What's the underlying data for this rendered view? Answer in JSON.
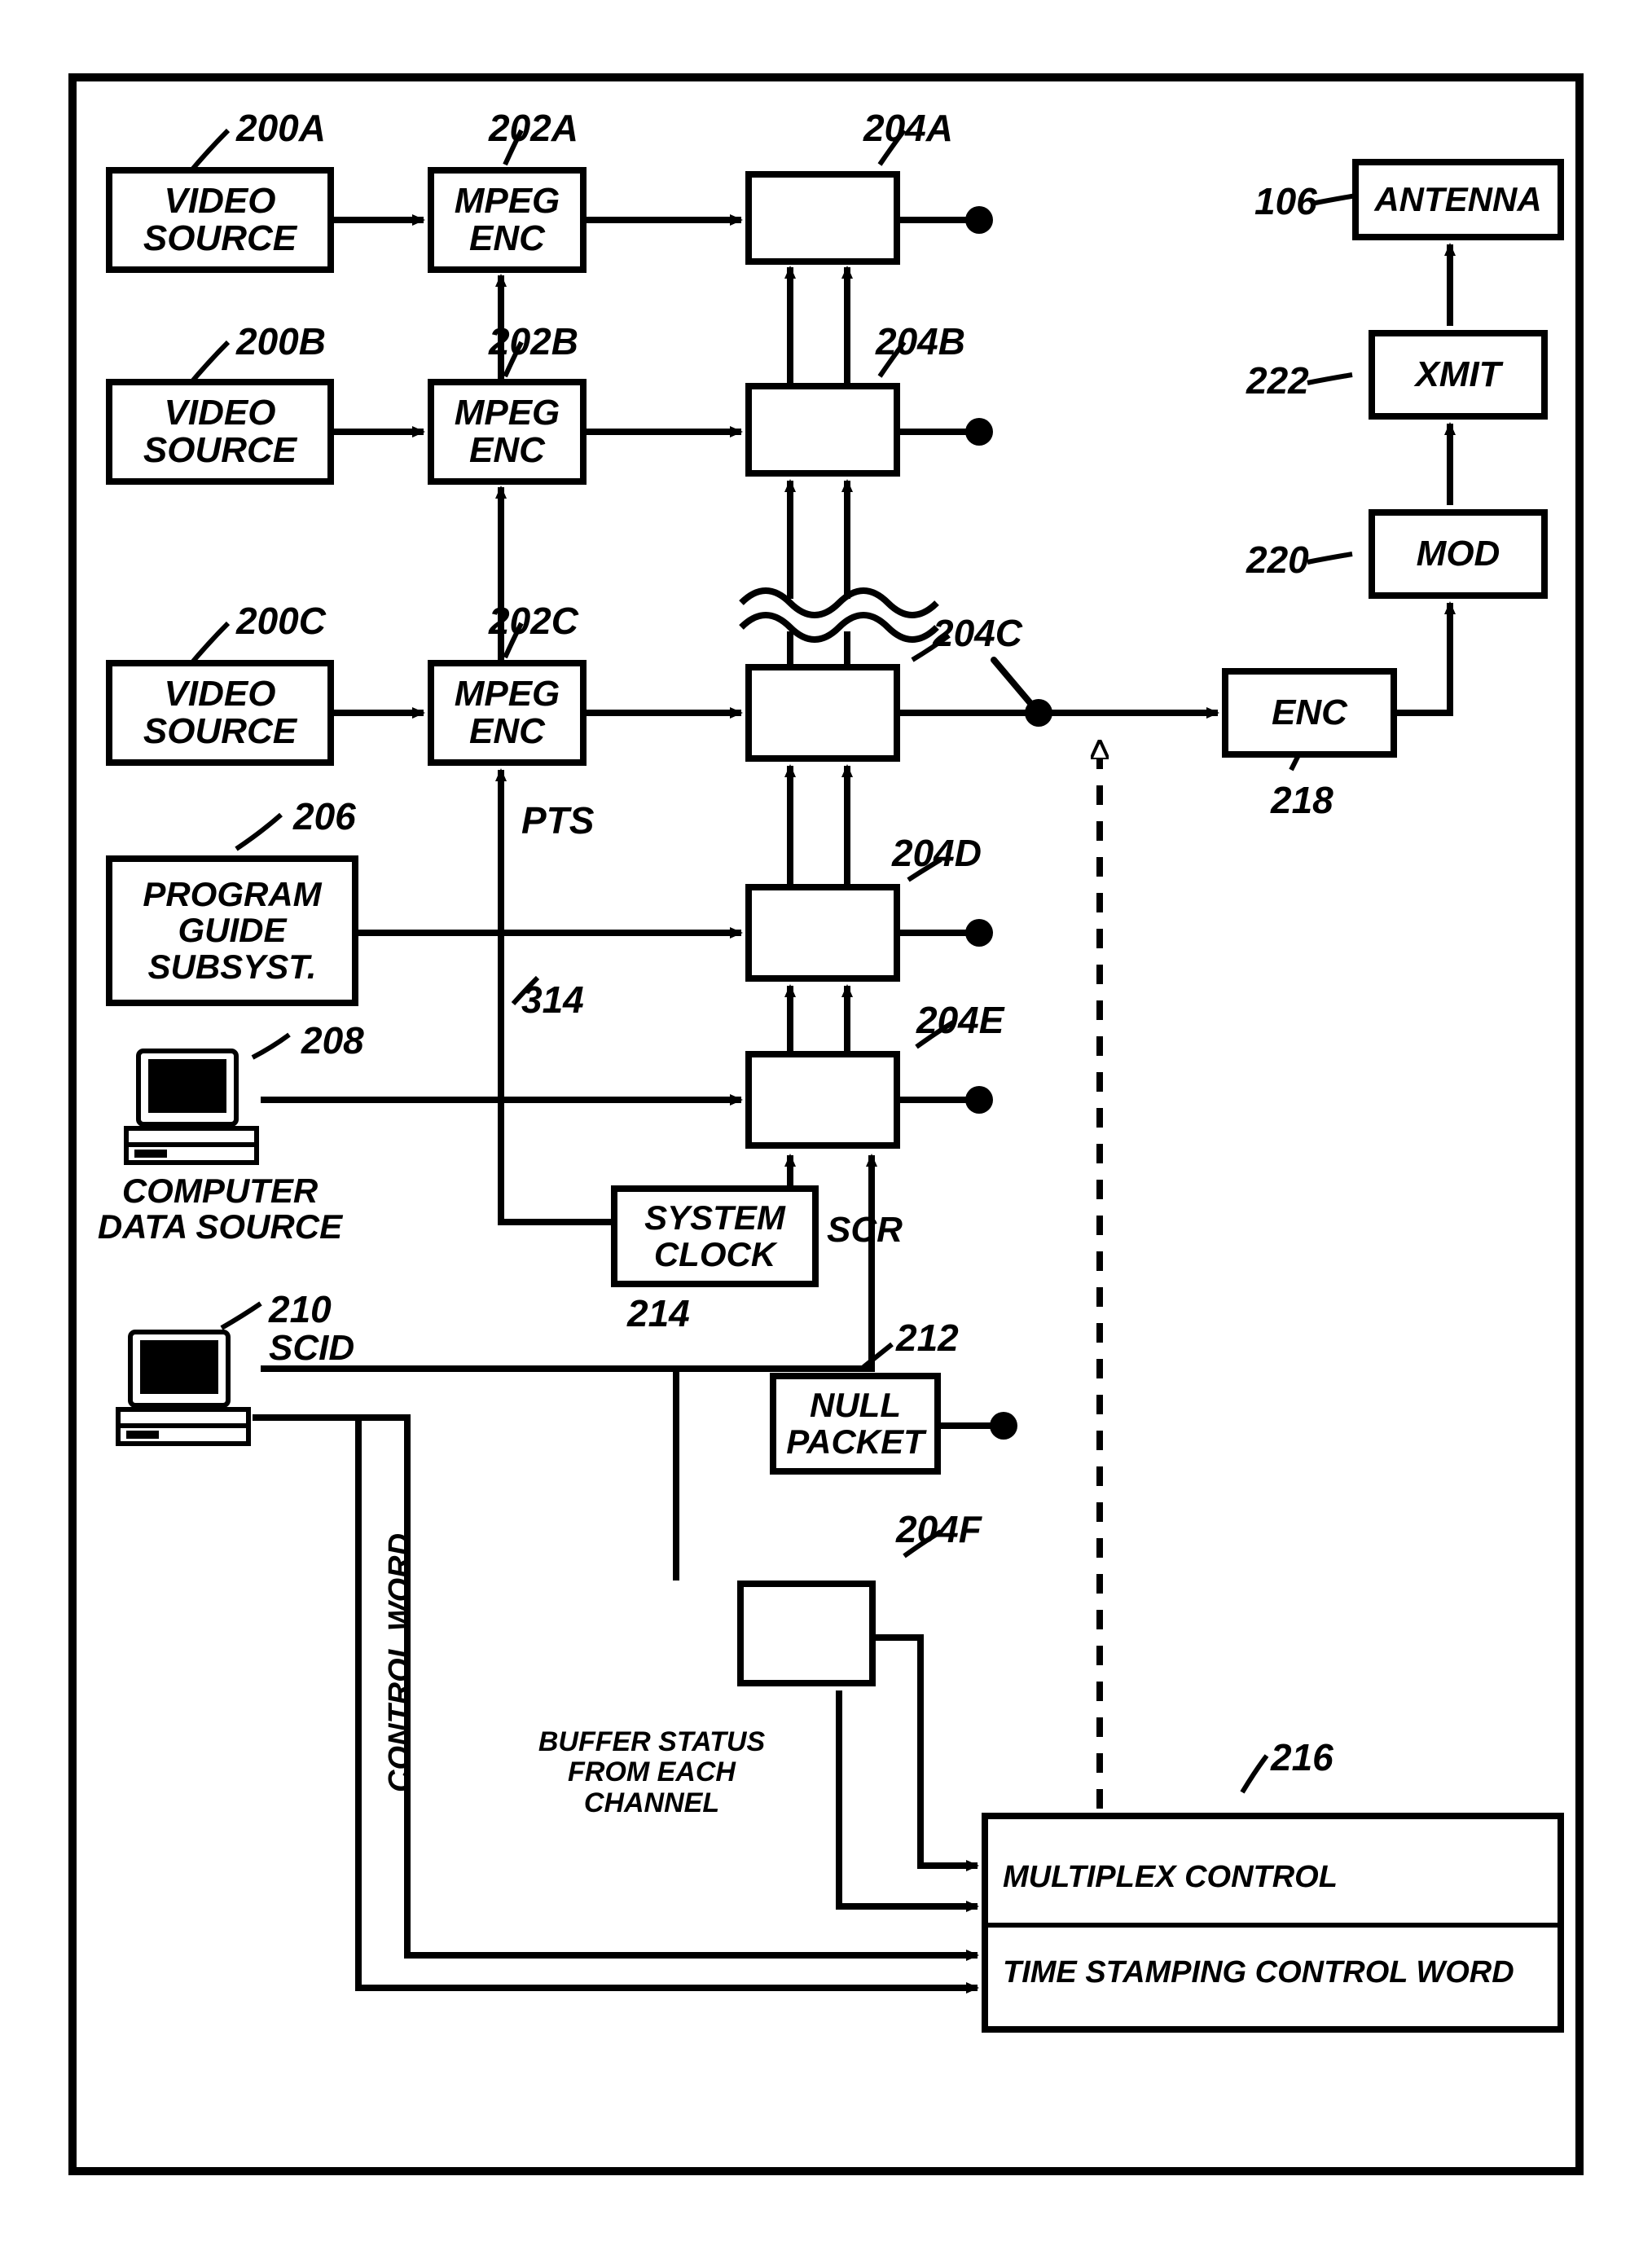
{
  "boxes": {
    "video_source_a": "VIDEO SOURCE",
    "video_source_b": "VIDEO SOURCE",
    "video_source_c": "VIDEO SOURCE",
    "mpeg_enc_a": "MPEG ENC",
    "mpeg_enc_b": "MPEG ENC",
    "mpeg_enc_c": "MPEG ENC",
    "program_guide": "PROGRAM GUIDE SUBSYST.",
    "system_clock": "SYSTEM CLOCK",
    "null_packet": "NULL PACKET",
    "antenna": "ANTENNA",
    "xmit": "XMIT",
    "mod": "MOD",
    "enc": "ENC",
    "mux_ctrl_line1": "MULTIPLEX CONTROL",
    "mux_ctrl_line2": "TIME STAMPING CONTROL WORD"
  },
  "refs": {
    "r200a": "200A",
    "r200b": "200B",
    "r200c": "200C",
    "r202a": "202A",
    "r202b": "202B",
    "r202c": "202C",
    "r204a": "204A",
    "r204b": "204B",
    "r204c": "204C",
    "r204d": "204D",
    "r204e": "204E",
    "r204f": "204F",
    "r206": "206",
    "r208": "208",
    "r210": "210",
    "r212": "212",
    "r214": "214",
    "r216": "216",
    "r218": "218",
    "r220": "220",
    "r222": "222",
    "r106": "106",
    "r314": "314"
  },
  "annot": {
    "pts": "PTS",
    "scr": "SCR",
    "scid": "SCID",
    "computer_data_source": "COMPUTER DATA SOURCE",
    "control_word": "CONTROL WORD",
    "buffer_status": "BUFFER STATUS FROM EACH CHANNEL"
  },
  "chart_data": {
    "type": "block-diagram",
    "blocks": [
      {
        "id": "200A",
        "label": "VIDEO SOURCE"
      },
      {
        "id": "200B",
        "label": "VIDEO SOURCE"
      },
      {
        "id": "200C",
        "label": "VIDEO SOURCE"
      },
      {
        "id": "202A",
        "label": "MPEG ENC"
      },
      {
        "id": "202B",
        "label": "MPEG ENC"
      },
      {
        "id": "202C",
        "label": "MPEG ENC"
      },
      {
        "id": "204A",
        "label": ""
      },
      {
        "id": "204B",
        "label": ""
      },
      {
        "id": "204C",
        "label": ""
      },
      {
        "id": "204D",
        "label": ""
      },
      {
        "id": "204E",
        "label": ""
      },
      {
        "id": "204F",
        "label": ""
      },
      {
        "id": "206",
        "label": "PROGRAM GUIDE SUBSYST."
      },
      {
        "id": "208",
        "label": "COMPUTER DATA SOURCE"
      },
      {
        "id": "210",
        "label": "SCID"
      },
      {
        "id": "212",
        "label": "NULL PACKET"
      },
      {
        "id": "214",
        "label": "SYSTEM CLOCK"
      },
      {
        "id": "216",
        "label": "MULTIPLEX CONTROL / TIME STAMPING CONTROL WORD"
      },
      {
        "id": "218",
        "label": "ENC"
      },
      {
        "id": "220",
        "label": "MOD"
      },
      {
        "id": "222",
        "label": "XMIT"
      },
      {
        "id": "106",
        "label": "ANTENNA"
      }
    ],
    "edges": [
      {
        "from": "200A",
        "to": "202A"
      },
      {
        "from": "200B",
        "to": "202B"
      },
      {
        "from": "200C",
        "to": "202C"
      },
      {
        "from": "202A",
        "to": "204A"
      },
      {
        "from": "202B",
        "to": "204B"
      },
      {
        "from": "202C",
        "to": "204C"
      },
      {
        "from": "202B",
        "to": "202A",
        "note": "chain up"
      },
      {
        "from": "202C",
        "to": "202B",
        "note": "chain up"
      },
      {
        "from": "206",
        "to": "204D"
      },
      {
        "from": "208",
        "to": "204E"
      },
      {
        "from": "210",
        "to": "204E",
        "label": "SCID"
      },
      {
        "from": "214",
        "to": "204E",
        "label": "SCR"
      },
      {
        "from": "214",
        "to": "202C",
        "label": "PTS / 314"
      },
      {
        "from": "212",
        "to": "switch_node"
      },
      {
        "from": "204A",
        "to": "switch_node"
      },
      {
        "from": "204B",
        "to": "switch_node"
      },
      {
        "from": "204C",
        "to": "switch_node"
      },
      {
        "from": "204D",
        "to": "switch_node"
      },
      {
        "from": "204E",
        "to": "switch_node"
      },
      {
        "from": "switch_node",
        "to": "218"
      },
      {
        "from": "218",
        "to": "220"
      },
      {
        "from": "220",
        "to": "222"
      },
      {
        "from": "222",
        "to": "106"
      },
      {
        "from": "204F",
        "to": "216",
        "label": "BUFFER STATUS FROM EACH CHANNEL"
      },
      {
        "from": "210",
        "to": "216",
        "label": "CONTROL WORD"
      },
      {
        "from": "216",
        "to": "switch_node",
        "style": "dashed",
        "note": "multiplex control"
      },
      {
        "from": "204B",
        "to": "204A",
        "note": "bus up"
      },
      {
        "from": "204C",
        "to": "204B",
        "note": "bus up"
      },
      {
        "from": "204D",
        "to": "204C",
        "note": "bus up"
      },
      {
        "from": "204E",
        "to": "204D",
        "note": "bus up"
      }
    ]
  }
}
